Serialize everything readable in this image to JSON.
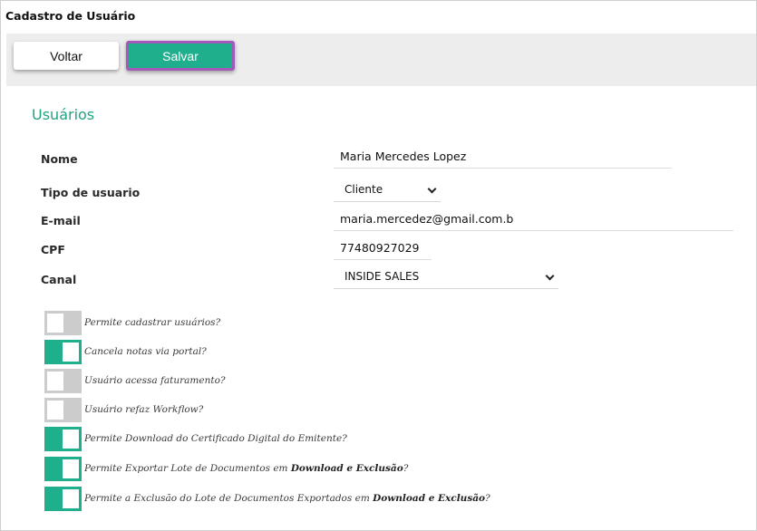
{
  "page_title": "Cadastro de Usuário",
  "toolbar": {
    "back_label": "Voltar",
    "save_label": "Salvar"
  },
  "section_title": "Usuários",
  "fields": {
    "nome": {
      "label": "Nome",
      "value": "Maria Mercedes Lopez"
    },
    "tipo": {
      "label": "Tipo de usuario",
      "value": "Cliente"
    },
    "email": {
      "label": "E-mail",
      "value": "maria.mercedez@gmail.com.b"
    },
    "cpf": {
      "label": "CPF",
      "value": "77480927029"
    },
    "canal": {
      "label": "Canal",
      "value": "INSIDE SALES"
    }
  },
  "permissions": [
    {
      "label": "Permite cadastrar usuários?",
      "enabled": false
    },
    {
      "label": "Cancela notas via portal?",
      "enabled": true
    },
    {
      "label": "Usuário acessa faturamento?",
      "enabled": false
    },
    {
      "label": "Usuário refaz Workflow?",
      "enabled": false
    },
    {
      "label": "Permite Download do Certificado Digital do Emitente?",
      "enabled": true
    },
    {
      "label_prefix": "Permite Exportar Lote de Documentos em ",
      "label_bold": "Download e Exclusão",
      "label_suffix": "?",
      "enabled": true
    },
    {
      "label_prefix": "Permite a Exclusão do Lote de Documentos Exportados em ",
      "label_bold": "Download e Exclusão",
      "label_suffix": "?",
      "enabled": true
    }
  ],
  "colors": {
    "accent": "#20af8c",
    "section_title": "#20a283",
    "focus_border": "#a259b8",
    "toggle_off": "#cccccc"
  }
}
